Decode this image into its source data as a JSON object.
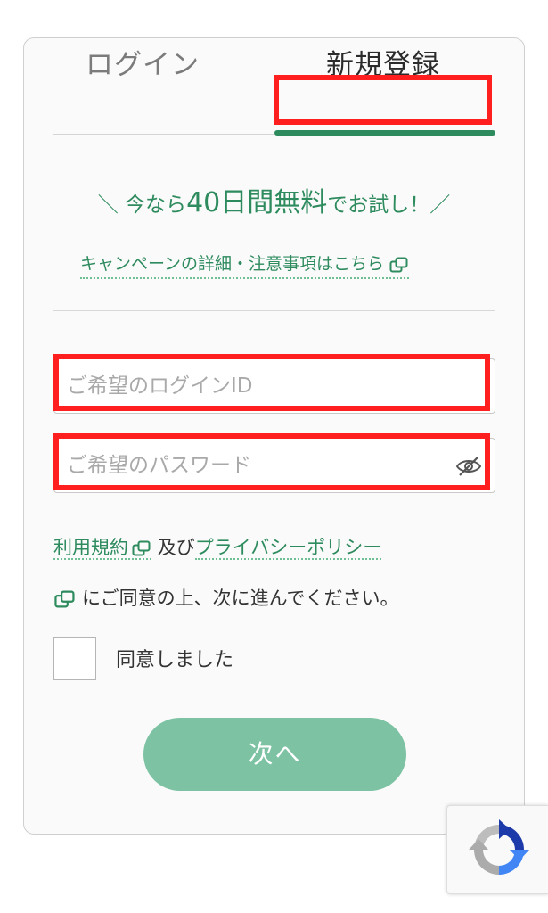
{
  "tabs": {
    "login_label": "ログイン",
    "signup_label": "新規登録"
  },
  "promo": {
    "prefix": "＼ 今なら",
    "highlight": "40日間無料",
    "suffix": "でお試し！／"
  },
  "campaign_link": {
    "label": "キャンペーンの詳細・注意事項はこちら"
  },
  "form": {
    "login_id": {
      "value": "",
      "placeholder": "ご希望のログインID"
    },
    "password": {
      "value": "",
      "placeholder": "ご希望のパスワード"
    }
  },
  "terms": {
    "terms_link": "利用規約",
    "and_text": "及び",
    "privacy_link": "プライバシーポリシー",
    "consent_text": "にご同意の上、次に進んでください。"
  },
  "agree": {
    "label": "同意しました",
    "checked": false
  },
  "next_button": {
    "label": "次へ"
  },
  "colors": {
    "brand_green": "#2e8b5e",
    "button_green": "#7cc2a3",
    "highlight_red": "#ff1f1f"
  },
  "icons": {
    "external": "external-link-icon",
    "password_toggle": "eye-slash-icon",
    "recaptcha": "recaptcha-icon"
  }
}
